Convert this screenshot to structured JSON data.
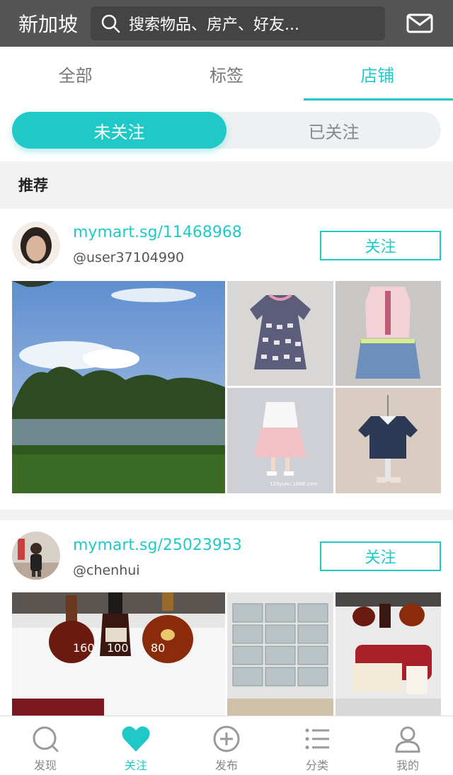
{
  "header": {
    "city": "新加坡",
    "search_placeholder": "搜索物品、房产、好友...",
    "icons": [
      "search-icon",
      "mail-icon"
    ]
  },
  "tabs": [
    {
      "label": "全部",
      "active": false
    },
    {
      "label": "标签",
      "active": false
    },
    {
      "label": "店铺",
      "active": true
    }
  ],
  "segment": {
    "unfollowed": "未关注",
    "followed": "已关注",
    "selected": "未关注"
  },
  "section_title": "推荐",
  "shops": [
    {
      "url": "mymart.sg/11468968",
      "username": "@user37104990",
      "follow_label": "关注",
      "watermark": "123yuku.1688.com"
    },
    {
      "url": "mymart.sg/25023953",
      "username": "@chenhui",
      "follow_label": "关注",
      "bottle_labels": [
        "160",
        "100",
        "80"
      ]
    }
  ],
  "bottom_nav": [
    {
      "label": "发现",
      "icon": "discover-icon",
      "active": false
    },
    {
      "label": "关注",
      "icon": "heart-icon",
      "active": true
    },
    {
      "label": "发布",
      "icon": "plus-circle-icon",
      "active": false
    },
    {
      "label": "分类",
      "icon": "list-icon",
      "active": false
    },
    {
      "label": "我的",
      "icon": "user-icon",
      "active": false
    }
  ],
  "colors": {
    "accent": "#1fc9c8",
    "topbar": "#555555",
    "background": "#f2f2f2"
  }
}
